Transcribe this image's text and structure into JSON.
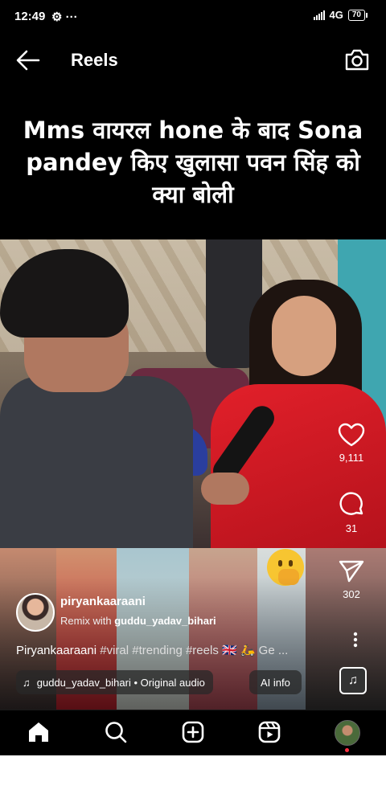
{
  "status_bar": {
    "time": "12:49",
    "network": "4G",
    "battery": "70"
  },
  "header": {
    "title": "Reels"
  },
  "video_caption": "Mms वायरल hone के बाद Sona pandey किए खुलासा पवन सिंह को क्या बोली",
  "actions": {
    "likes": "9,111",
    "comments": "31",
    "shares": "302"
  },
  "post": {
    "username": "piryankaaraani",
    "remix_prefix": "Remix with",
    "remix_user": "guddu_yadav_bihari",
    "caption_user": "Piryankaaraani",
    "caption_tags": "#viral #trending #reels 🇬🇧 🛵 Ge ...",
    "audio": "guddu_yadav_bihari • Original audio",
    "ai_info": "AI info"
  },
  "colors": {
    "background": "#000000",
    "notification_dot": "#ff3040",
    "text": "#ffffff"
  },
  "icons": [
    "back-arrow-icon",
    "camera-icon",
    "heart-icon",
    "comment-icon",
    "send-icon",
    "more-icon",
    "music-note-icon",
    "home-icon",
    "search-icon",
    "create-icon",
    "reels-icon"
  ]
}
